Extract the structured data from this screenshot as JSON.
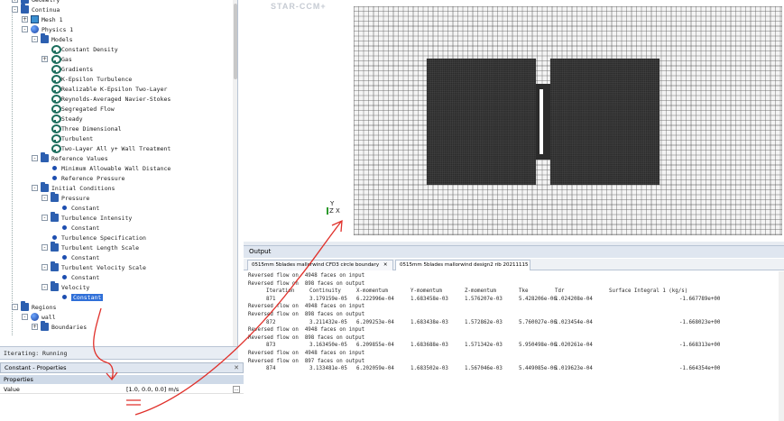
{
  "tree": [
    {
      "label": "Geometry",
      "indent": 1,
      "icon": "folder",
      "exp": "+"
    },
    {
      "label": "Continua",
      "indent": 1,
      "icon": "folder",
      "exp": "-"
    },
    {
      "label": "Mesh 1",
      "indent": 2,
      "icon": "mesh",
      "exp": "+"
    },
    {
      "label": "Physics 1",
      "indent": 2,
      "icon": "ball",
      "exp": "-"
    },
    {
      "label": "Models",
      "indent": 3,
      "icon": "folder",
      "exp": "-"
    },
    {
      "label": "Constant Density",
      "indent": 4,
      "icon": "model",
      "exp": ""
    },
    {
      "label": "Gas",
      "indent": 4,
      "icon": "model",
      "exp": "+"
    },
    {
      "label": "Gradients",
      "indent": 4,
      "icon": "model",
      "exp": ""
    },
    {
      "label": "K-Epsilon Turbulence",
      "indent": 4,
      "icon": "model",
      "exp": ""
    },
    {
      "label": "Realizable K-Epsilon Two-Layer",
      "indent": 4,
      "icon": "model",
      "exp": ""
    },
    {
      "label": "Reynolds-Averaged Navier-Stokes",
      "indent": 4,
      "icon": "model",
      "exp": ""
    },
    {
      "label": "Segregated Flow",
      "indent": 4,
      "icon": "model",
      "exp": ""
    },
    {
      "label": "Steady",
      "indent": 4,
      "icon": "model",
      "exp": ""
    },
    {
      "label": "Three Dimensional",
      "indent": 4,
      "icon": "model",
      "exp": ""
    },
    {
      "label": "Turbulent",
      "indent": 4,
      "icon": "model",
      "exp": ""
    },
    {
      "label": "Two-Layer All y+ Wall Treatment",
      "indent": 4,
      "icon": "model",
      "exp": ""
    },
    {
      "label": "Reference Values",
      "indent": 3,
      "icon": "folder",
      "exp": "-"
    },
    {
      "label": "Minimum Allowable Wall Distance",
      "indent": 4,
      "icon": "dot",
      "exp": ""
    },
    {
      "label": "Reference Pressure",
      "indent": 4,
      "icon": "dot",
      "exp": ""
    },
    {
      "label": "Initial Conditions",
      "indent": 3,
      "icon": "folder",
      "exp": "-"
    },
    {
      "label": "Pressure",
      "indent": 4,
      "icon": "folder",
      "exp": "-"
    },
    {
      "label": "Constant",
      "indent": 5,
      "icon": "dot",
      "exp": ""
    },
    {
      "label": "Turbulence Intensity",
      "indent": 4,
      "icon": "folder",
      "exp": "-"
    },
    {
      "label": "Constant",
      "indent": 5,
      "icon": "dot",
      "exp": ""
    },
    {
      "label": "Turbulence Specification",
      "indent": 4,
      "icon": "dot",
      "exp": ""
    },
    {
      "label": "Turbulent Length Scale",
      "indent": 4,
      "icon": "folder",
      "exp": "-"
    },
    {
      "label": "Constant",
      "indent": 5,
      "icon": "dot",
      "exp": ""
    },
    {
      "label": "Turbulent Velocity Scale",
      "indent": 4,
      "icon": "folder",
      "exp": "-"
    },
    {
      "label": "Constant",
      "indent": 5,
      "icon": "dot",
      "exp": ""
    },
    {
      "label": "Velocity",
      "indent": 4,
      "icon": "folder",
      "exp": "-"
    },
    {
      "label": "Constant",
      "indent": 5,
      "icon": "dot",
      "exp": "",
      "selected": true
    },
    {
      "label": "Regions",
      "indent": 1,
      "icon": "folder",
      "exp": "-"
    },
    {
      "label": "wall",
      "indent": 2,
      "icon": "ball",
      "exp": "-"
    },
    {
      "label": "Boundaries",
      "indent": 3,
      "icon": "folder",
      "exp": "+"
    }
  ],
  "status": "Iterating: Running",
  "properties": {
    "title": "Constant - Properties",
    "section": "Properties",
    "key": "Value",
    "value": "[1.0, 0.0, 0.0] m/s",
    "btn": "...",
    "close": "✕"
  },
  "graphics": {
    "logo": "STAR-CCM+",
    "axis_y": "Y",
    "axis_zx": "Z  X"
  },
  "output": {
    "title": "Output",
    "tabs": [
      "0515mm 5blades mallorwind CFD3 circle boundary",
      "0515mm 5blades mallorwind design2 rib 20211115"
    ],
    "tab_close": "✕",
    "header": [
      "Iteration",
      "Continuity",
      "X-momentum",
      "Y-momentum",
      "Z-momentum",
      "Tke",
      "Tdr",
      "Surface Integral 1 (kg/s)"
    ],
    "lines": [
      {
        "type": "msg",
        "text": "Reversed flow on  4948 faces on input"
      },
      {
        "type": "msg",
        "text": "Reversed flow on  898 faces on output"
      },
      {
        "type": "hdr"
      },
      {
        "type": "row",
        "cells": [
          "871",
          "3.179159e-05",
          "6.222996e-04",
          "1.683458e-03",
          "1.576207e-03",
          "5.428206e-06",
          "1.024208e-04",
          "-1.667789e+00"
        ]
      },
      {
        "type": "msg",
        "text": "Reversed flow on  4948 faces on input"
      },
      {
        "type": "msg",
        "text": "Reversed flow on  898 faces on output"
      },
      {
        "type": "row",
        "cells": [
          "872",
          "3.211432e-05",
          "6.209253e-04",
          "1.683438e-03",
          "1.572862e-03",
          "5.760027e-06",
          "1.023454e-04",
          "-1.668023e+00"
        ]
      },
      {
        "type": "msg",
        "text": "Reversed flow on  4948 faces on input"
      },
      {
        "type": "msg",
        "text": "Reversed flow on  898 faces on output"
      },
      {
        "type": "row",
        "cells": [
          "873",
          "3.163450e-05",
          "6.209855e-04",
          "1.683688e-03",
          "1.571342e-03",
          "5.950498e-06",
          "1.020261e-04",
          "-1.668313e+00"
        ]
      },
      {
        "type": "msg",
        "text": "Reversed flow on  4948 faces on input"
      },
      {
        "type": "msg",
        "text": "Reversed flow on  897 faces on output"
      },
      {
        "type": "row",
        "cells": [
          "874",
          "3.133481e-05",
          "6.202059e-04",
          "1.683502e-03",
          "1.567046e-03",
          "5.449085e-06",
          "1.019623e-04",
          "-1.664354e+00"
        ]
      }
    ]
  },
  "colors": {
    "selection": "#2f6fd8",
    "annotation": "#e0302a",
    "mesh_dark": "#2b2b2b"
  }
}
